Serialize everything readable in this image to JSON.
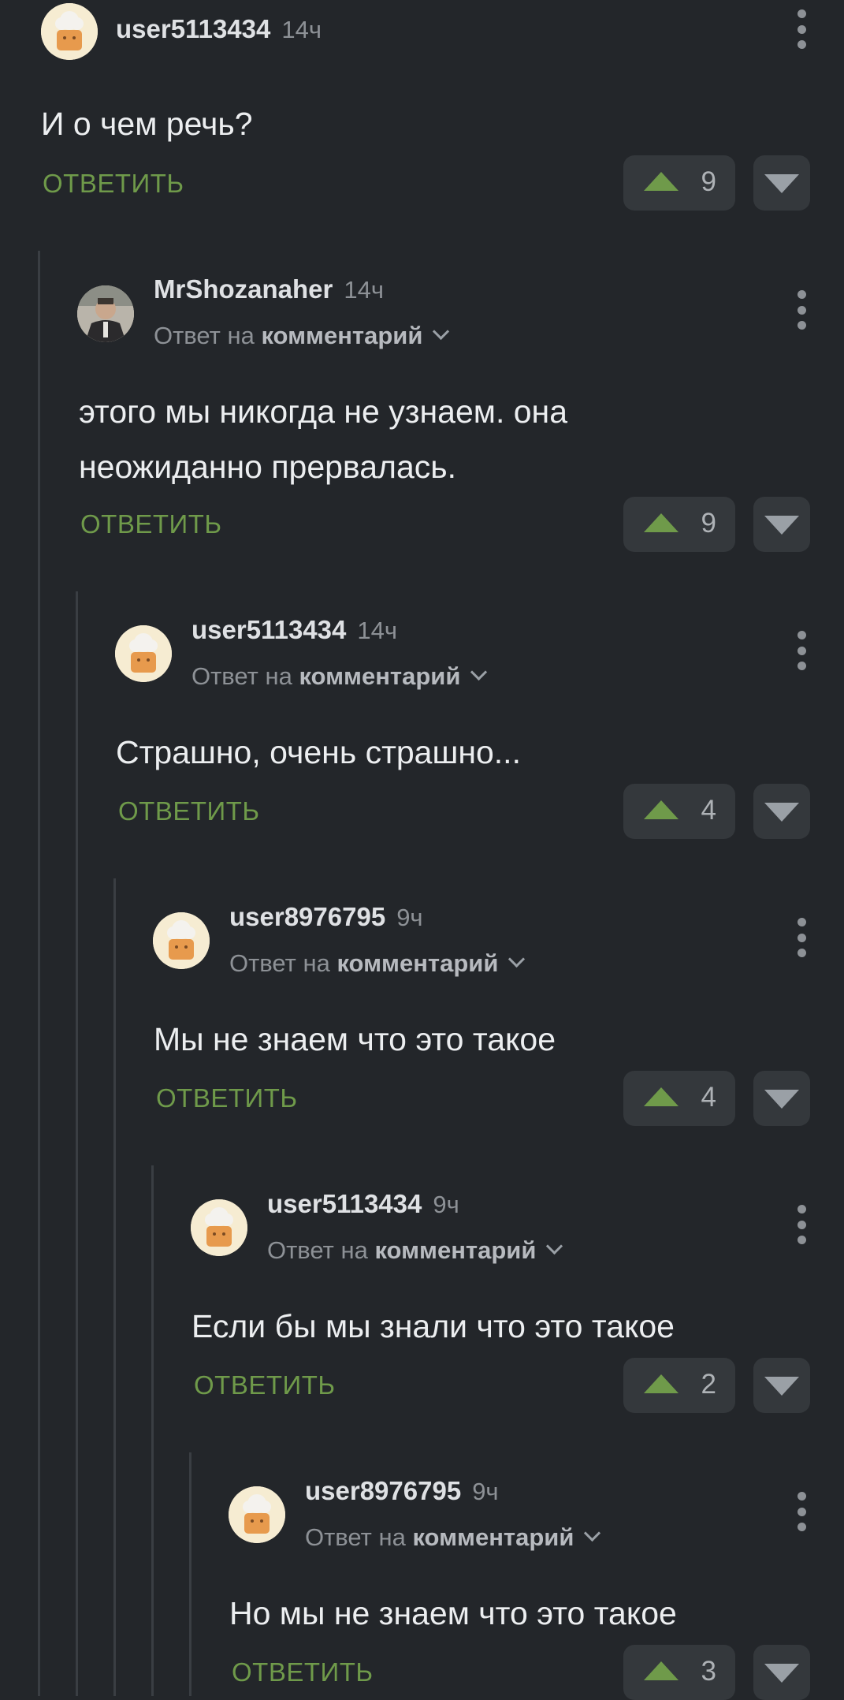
{
  "ui": {
    "reply_label": "ОТВЕТИТЬ",
    "reply_prefix": "Ответ на",
    "reply_target": "комментарий"
  },
  "comments": [
    {
      "username": "user5113434",
      "time": "14ч",
      "text": "И о чем речь?",
      "votes": "9",
      "avatar": "chef-hat-avatar"
    },
    {
      "username": "MrShozanaher",
      "time": "14ч",
      "text": "этого мы никогда не узнаем. она неожиданно прервалась.",
      "votes": "9",
      "avatar": "photo-avatar"
    },
    {
      "username": "user5113434",
      "time": "14ч",
      "text": "Страшно, очень страшно...",
      "votes": "4",
      "avatar": "chef-hat-avatar"
    },
    {
      "username": "user8976795",
      "time": "9ч",
      "text": "Мы не знаем что это такое",
      "votes": "4",
      "avatar": "chef-hat-avatar"
    },
    {
      "username": "user5113434",
      "time": "9ч",
      "text": "Если бы мы знали что это такое",
      "votes": "2",
      "avatar": "chef-hat-avatar"
    },
    {
      "username": "user8976795",
      "time": "9ч",
      "text": "Но мы не знаем что это такое",
      "votes": "3",
      "avatar": "chef-hat-avatar"
    }
  ],
  "colors": {
    "background": "#23262a",
    "accent_green": "#6f9a4a",
    "vote_bg": "#34383c"
  }
}
